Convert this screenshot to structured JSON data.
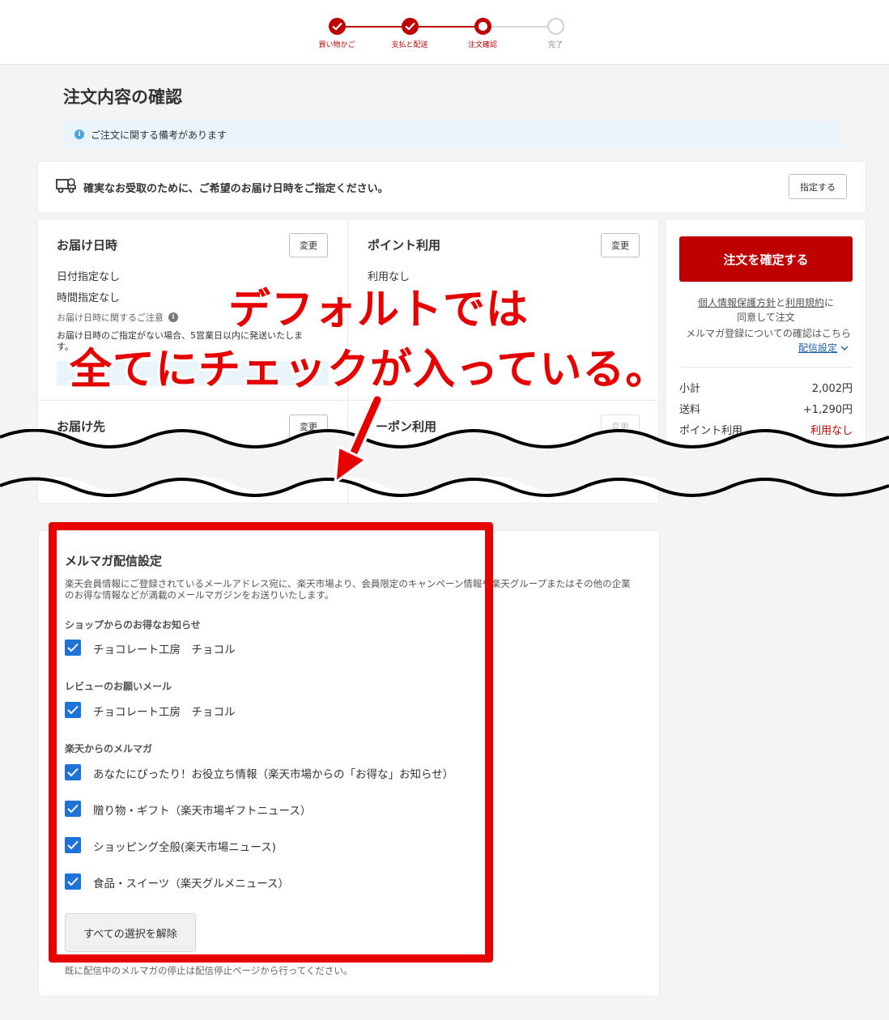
{
  "progress": {
    "steps": [
      {
        "label": "買い物かご",
        "state": "done"
      },
      {
        "label": "支払と配送",
        "state": "done"
      },
      {
        "label": "注文確認",
        "state": "current"
      },
      {
        "label": "完了",
        "state": "todo"
      }
    ]
  },
  "page_title": "注文内容の確認",
  "notice": {
    "icon": "info-icon",
    "text": "ご注文に関する備考があります"
  },
  "delivery_banner": {
    "icon": "delivery-truck-icon",
    "text": "確実なお受取のために、ご希望のお届け日時をご指定ください。",
    "button": "指定する"
  },
  "delivery_datetime": {
    "title": "お届け日時",
    "change": "変更",
    "date": "日付指定なし",
    "time": "時間指定なし",
    "note_label": "お届け日時に関するご注意",
    "note_text": "お届け日時のご指定がない場合、5営業日以内に発送いたしま",
    "note_text2": "す。"
  },
  "points": {
    "title": "ポイント利用",
    "change": "変更",
    "value": "利用なし"
  },
  "destination": {
    "title": "お届け先",
    "change": "変更"
  },
  "coupon": {
    "title": "ーポン利用",
    "change": "変更"
  },
  "order": {
    "confirm_button": "注文を確定する",
    "privacy_link": "個人情報保護方針",
    "and": "と",
    "terms_link": "利用規約",
    "agree_suffix": "に",
    "agree_line2": "同意して注文",
    "mailmag_note": "メルマガ登録についての確認はこちら",
    "delivery_settings_link": "配信設定"
  },
  "summary": [
    {
      "label": "小計",
      "value": "2,002円",
      "accent": false
    },
    {
      "label": "送料",
      "value": "+1,290円",
      "accent": false
    },
    {
      "label": "ポイント利用",
      "value": "利用なし",
      "accent": true
    }
  ],
  "annotation": {
    "line1": "デフォルトでは",
    "line2": "全てにチェックが入っている。"
  },
  "mail_magazine": {
    "title": "メルマガ配信設定",
    "description": "楽天会員情報にご登録されているメールアドレス宛に、楽天市場より、会員限定のキャンペーン情報や楽天グループまたはその他の企業のお得な情報などが満載のメールマガジンをお送りいたします。",
    "groups": [
      {
        "heading": "ショップからのお得なお知らせ",
        "items": [
          {
            "label": "チョコレート工房　チョコル",
            "checked": true
          }
        ]
      },
      {
        "heading": "レビューのお願いメール",
        "items": [
          {
            "label": "チョコレート工房　チョコル",
            "checked": true
          }
        ]
      },
      {
        "heading": "楽天からのメルマガ",
        "items": [
          {
            "label": "あなたにぴったり！お役立ち情報（楽天市場からの「お得な」お知らせ）",
            "checked": true
          },
          {
            "label": "贈り物・ギフト（楽天市場ギフトニュース）",
            "checked": true
          },
          {
            "label": "ショッピング全般(楽天市場ニュース)",
            "checked": true
          },
          {
            "label": "食品・スイーツ（楽天グルメニュース）",
            "checked": true
          }
        ]
      }
    ],
    "clear_button": "すべての選択を解除",
    "footer_note": "既に配信中のメルマガの停止は配信停止ページから行ってください。"
  },
  "colors": {
    "brand_red": "#bf0000",
    "annotation_red": "#e60000",
    "checkbox_blue": "#1d73d8"
  }
}
